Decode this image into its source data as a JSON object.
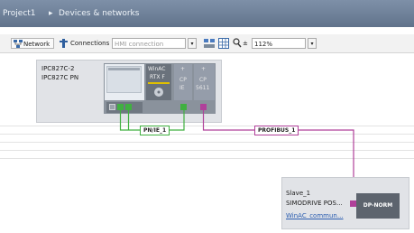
{
  "breadcrumb": {
    "project": "Project1",
    "separator": "▸",
    "section": "Devices & networks"
  },
  "toolbar": {
    "network_label": "Network",
    "connections_label": "Connections",
    "connection_type_value": "HMI connection",
    "dropdown_arrow": "▾",
    "zoom_icon_text": "±",
    "zoom_value": "112%"
  },
  "device1": {
    "name": "IPC827C-2",
    "type": "IPC827C PN",
    "slot_winac_line1": "WinAC",
    "slot_winac_line2": "RTX F",
    "slot_cp1_line1": "CP",
    "slot_cp1_line2": "IE",
    "slot_cp2_line1": "CP",
    "slot_cp2_line2": "5611",
    "slot_plus_1": "+",
    "slot_plus_2": "+"
  },
  "networks": {
    "pnie_label": "PN/IE_1",
    "profibus_label": "PROFIBUS_1"
  },
  "device2": {
    "name": "Slave_1",
    "type": "SIMODRIVE POS...",
    "link": "WinAC_commun...",
    "module_label": "DP-NORM"
  },
  "colors": {
    "titlebar": "#6f819a",
    "profinet_green": "#40b040",
    "profibus_magenta": "#b0409a",
    "device_bg": "#e1e3e7",
    "rack_dark": "#8a929c"
  }
}
